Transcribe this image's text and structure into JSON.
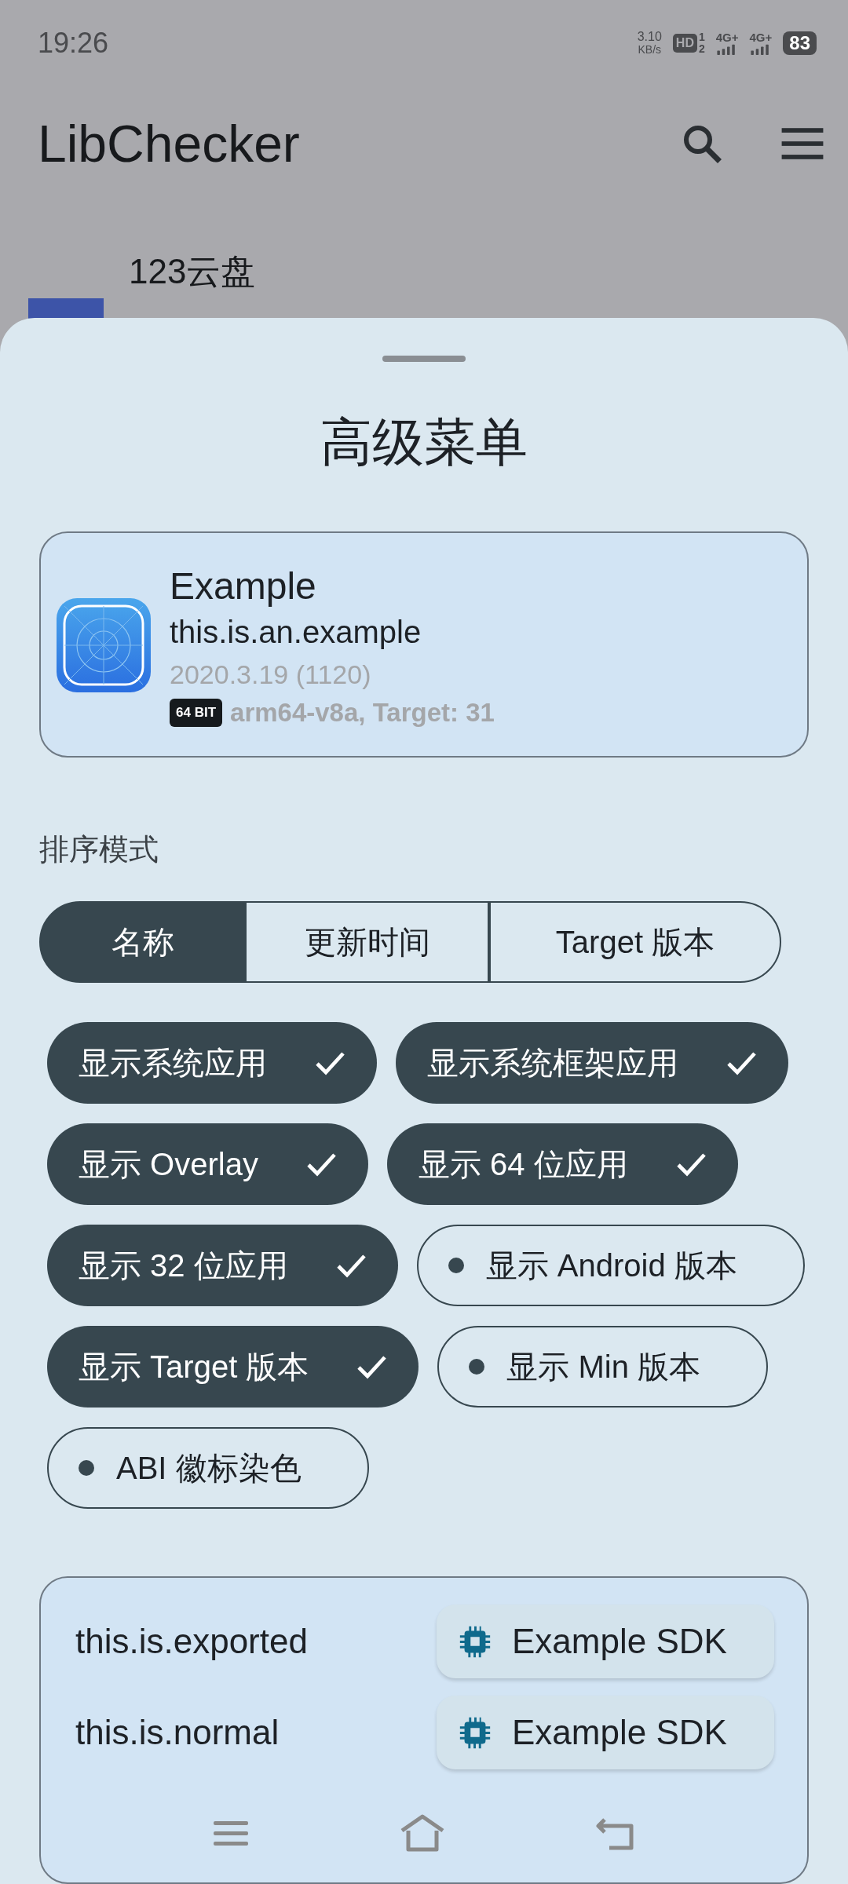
{
  "status_bar": {
    "time": "19:26",
    "speed_value": "3.10",
    "speed_unit": "KB/s",
    "volte": "HD",
    "volte_slots": [
      "1",
      "2"
    ],
    "networks": [
      "4G+",
      "4G+"
    ],
    "battery": "83"
  },
  "app_bar": {
    "title": "LibChecker"
  },
  "background_list": [
    {
      "name": "123云盘"
    }
  ],
  "sheet": {
    "title": "高级菜单",
    "app_card": {
      "name": "Example",
      "package": "this.is.an.example",
      "version": "2020.3.19 (1120)",
      "abi_badge": "64 BIT",
      "abi_text": "arm64-v8a, Target: 31"
    },
    "sort_label": "排序模式",
    "sort_modes": [
      {
        "label": "名称",
        "selected": true
      },
      {
        "label": "更新时间",
        "selected": false
      },
      {
        "label": "Target 版本",
        "selected": false
      }
    ],
    "filters": [
      {
        "label": "显示系统应用",
        "checked": true
      },
      {
        "label": "显示系统框架应用",
        "checked": true
      },
      {
        "label": "显示 Overlay",
        "checked": true
      },
      {
        "label": "显示 64 位应用",
        "checked": true
      },
      {
        "label": "显示 32 位应用",
        "checked": true
      },
      {
        "label": "显示 Android 版本",
        "checked": false
      },
      {
        "label": "显示 Target 版本",
        "checked": true
      },
      {
        "label": "显示 Min 版本",
        "checked": false
      },
      {
        "label": "ABI 徽标染色",
        "checked": false
      }
    ],
    "component_rows": [
      {
        "name": "this.is.exported",
        "sdk_label": "Example SDK"
      },
      {
        "name": "this.is.normal",
        "sdk_label": "Example SDK"
      }
    ]
  }
}
